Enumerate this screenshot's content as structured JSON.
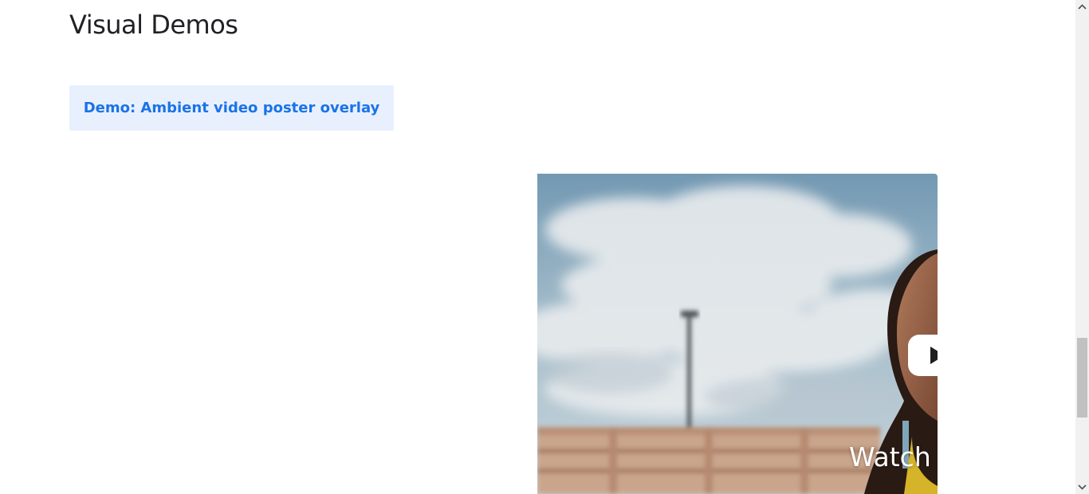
{
  "section": {
    "title": "Visual Demos"
  },
  "demo_button": {
    "label": "Demo: Ambient video poster overlay"
  },
  "video": {
    "caption": "Watch t",
    "play_icon": "play-icon"
  },
  "scrollbar": {
    "up_icon": "chevron-up-icon",
    "down_icon": "chevron-down-icon"
  },
  "colors": {
    "title": "#202124",
    "button_bg": "#e8f0fe",
    "button_text": "#1a73e8",
    "scroll_track": "#f1f1f1",
    "scroll_thumb": "#c1c1c1"
  }
}
